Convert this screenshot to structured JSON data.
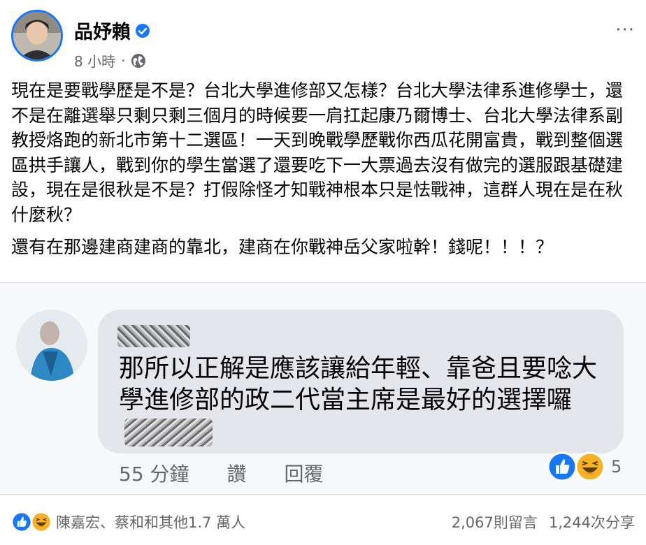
{
  "post": {
    "author": "品妤賴",
    "time": "8 小時",
    "separator": "·",
    "more": "···",
    "paragraphs": [
      "現在是要戰學歷是不是？台北大學進修部又怎樣？台北大學法律系進修學士，還不是在離選舉只剩只剩三個月的時候要一肩扛起康乃爾博士、台北大學法律系副教授烙跑的新北市第十二選區！一天到晚戰學歷戰你西瓜花開富貴，戰到整個選區拱手讓人，戰到你的學生當選了還要吃下一大票過去沒有做完的選服跟基礎建設，現在是很秋是不是？打假除怪才知戰神根本只是怯戰神，這群人現在是在秋什麼秋？",
      "還有在那邊建商建商的靠北，建商在你戰神岳父家啦幹！錢呢！！！？"
    ]
  },
  "comment": {
    "text": "那所以正解是應該讓給年輕、靠爸且要唸大學進修部的政二代當主席是最好的選擇囉",
    "time": "55 分鐘",
    "like": "讚",
    "reply": "回覆",
    "reaction_count": "5"
  },
  "footer": {
    "reactors": "陳嘉宏、蔡和和其他1.7 萬人",
    "comments": "2,067則留言",
    "shares": "1,244次分享"
  },
  "colors": {
    "brand_blue": "#1877f2",
    "haha_yellow": "#f7b125",
    "muted": "#65676b"
  },
  "icons": [
    "verified-icon",
    "globe-icon",
    "like-reaction-icon",
    "haha-reaction-icon",
    "more-icon"
  ]
}
